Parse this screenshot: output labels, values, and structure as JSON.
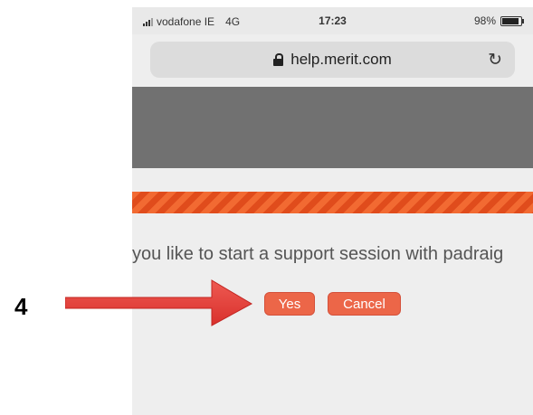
{
  "status_bar": {
    "carrier": "vodafone IE",
    "network": "4G",
    "time": "17:23",
    "battery": "98%"
  },
  "browser": {
    "url": "help.merit.com",
    "lock_icon": "lock-icon",
    "reload_icon": "reload-icon"
  },
  "dialog": {
    "prompt": "you like to start a support session with padraig",
    "yes_label": "Yes",
    "cancel_label": "Cancel"
  },
  "annotation": {
    "step": "4"
  },
  "colors": {
    "accent_orange": "#ec6648",
    "stripe_orange": "#f26a32",
    "arrow_red": "#e8413b",
    "banner_gray": "#717171"
  }
}
